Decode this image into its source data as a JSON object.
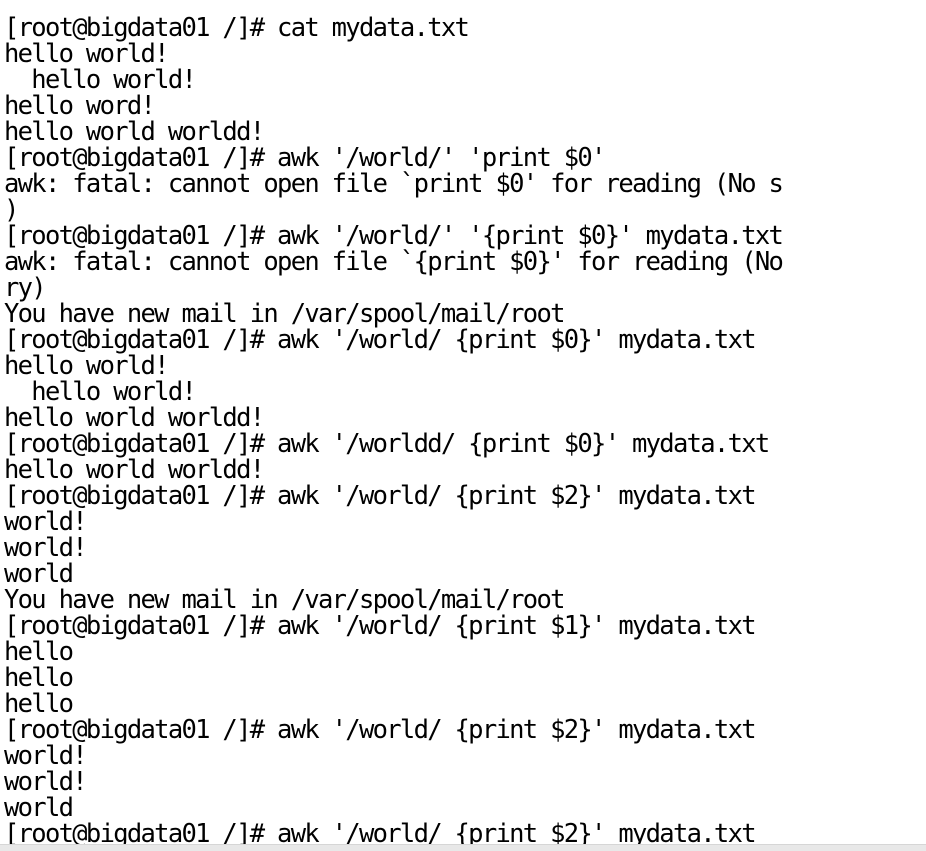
{
  "terminal": {
    "lines": [
      "                                    ",
      "[root@bigdata01 /]# cat mydata.txt",
      "hello world!",
      "  hello world!",
      "hello word!",
      "hello world worldd!",
      "[root@bigdata01 /]# awk '/world/' 'print $0'",
      "awk: fatal: cannot open file `print $0' for reading (No s",
      ")",
      "[root@bigdata01 /]# awk '/world/' '{print $0}' mydata.txt",
      "awk: fatal: cannot open file `{print $0}' for reading (No",
      "ry)",
      "You have new mail in /var/spool/mail/root",
      "[root@bigdata01 /]# awk '/world/ {print $0}' mydata.txt",
      "hello world!",
      "  hello world!",
      "hello world worldd!",
      "[root@bigdata01 /]# awk '/worldd/ {print $0}' mydata.txt",
      "hello world worldd!",
      "[root@bigdata01 /]# awk '/world/ {print $2}' mydata.txt",
      "world!",
      "world!",
      "world",
      "You have new mail in /var/spool/mail/root",
      "[root@bigdata01 /]# awk '/world/ {print $1}' mydata.txt",
      "hello",
      "hello",
      "hello",
      "[root@bigdata01 /]# awk '/world/ {print $2}' mydata.txt",
      "world!",
      "world!",
      "world",
      "[root@bigdata01 /]# awk '/world/ {print $2}' mydata.txt"
    ]
  }
}
